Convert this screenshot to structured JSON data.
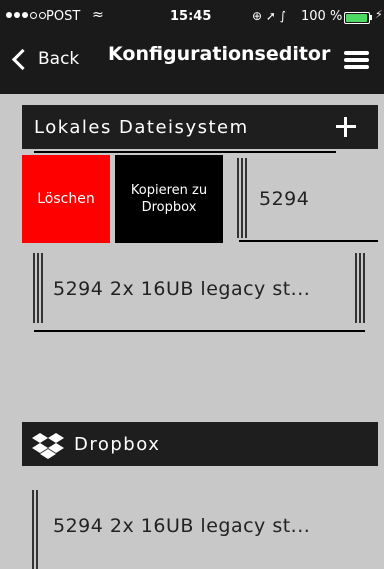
{
  "status_bar": {
    "carrier": "POST",
    "time": "15:45",
    "battery_text": "100 %",
    "battery_level": 1.0,
    "icons": [
      "signal-dots-icon",
      "wifi-icon",
      "lock-rotation-icon",
      "location-arrow-icon",
      "bluetooth-icon",
      "battery-icon",
      "charging-icon"
    ]
  },
  "nav": {
    "back_label": "Back",
    "title": "Konfigurationseditor"
  },
  "local_section": {
    "title": "Lokales Dateisystem",
    "delete_label": "Löschen",
    "copy_label": "Kopieren zu\nDropbox",
    "selected_item": "5294",
    "items": [
      "5294 2x 16UB legacy st..."
    ]
  },
  "dropbox_section": {
    "title": "Dropbox",
    "items": [
      "5294 2x 16UB legacy st..."
    ]
  },
  "colors": {
    "background": "#c8c8c8",
    "bar": "#1a1a1a",
    "delete": "#ff0000",
    "battery": "#4cd964"
  }
}
